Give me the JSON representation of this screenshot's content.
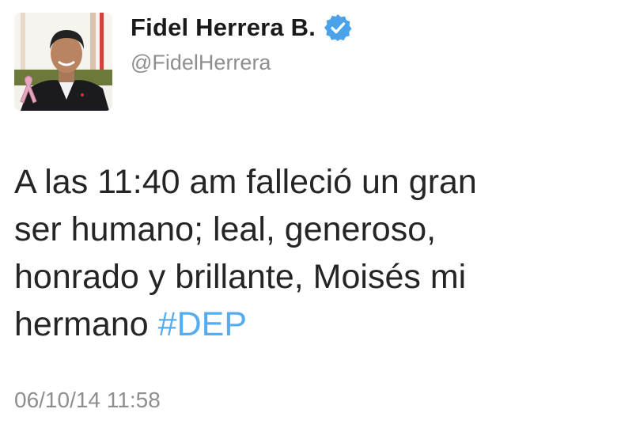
{
  "author": {
    "display_name": "Fidel Herrera B.",
    "handle": "@FidelHerrera",
    "verified": true,
    "avatar_icon": "profile-photo-man-in-suit-with-pink-ribbon",
    "verified_icon": "verified-badge-icon"
  },
  "tweet": {
    "lines": [
      "A las 11:40 am falleció un gran",
      "ser humano; leal, generoso,",
      "honrado y brillante, Moisés mi",
      "hermano "
    ],
    "hashtag": "#DEP",
    "timestamp": "06/10/14 11:58"
  },
  "colors": {
    "hashtag": "#55acee",
    "verified": "#4aa3e8",
    "secondary_text": "#8e8e8e",
    "primary_text": "#252525"
  }
}
